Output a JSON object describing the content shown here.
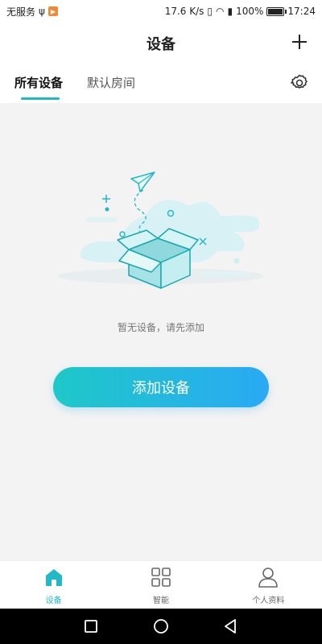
{
  "status_bar": {
    "carrier": "无服务",
    "speed": "17.6 K/s",
    "battery": "100%",
    "time": "17:24"
  },
  "header": {
    "title": "设备"
  },
  "tabs": [
    {
      "label": "所有设备"
    },
    {
      "label": "默认房间"
    }
  ],
  "empty_state": {
    "message": "暂无设备，请先添加",
    "button_label": "添加设备"
  },
  "bottom_nav": [
    {
      "label": "设备",
      "icon": "home-icon"
    },
    {
      "label": "智能",
      "icon": "grid-icon"
    },
    {
      "label": "个人资料",
      "icon": "person-icon"
    }
  ],
  "colors": {
    "accent": "#21b8c7",
    "button_gradient_start": "#1ec8c8",
    "button_gradient_end": "#2aa9f4"
  }
}
